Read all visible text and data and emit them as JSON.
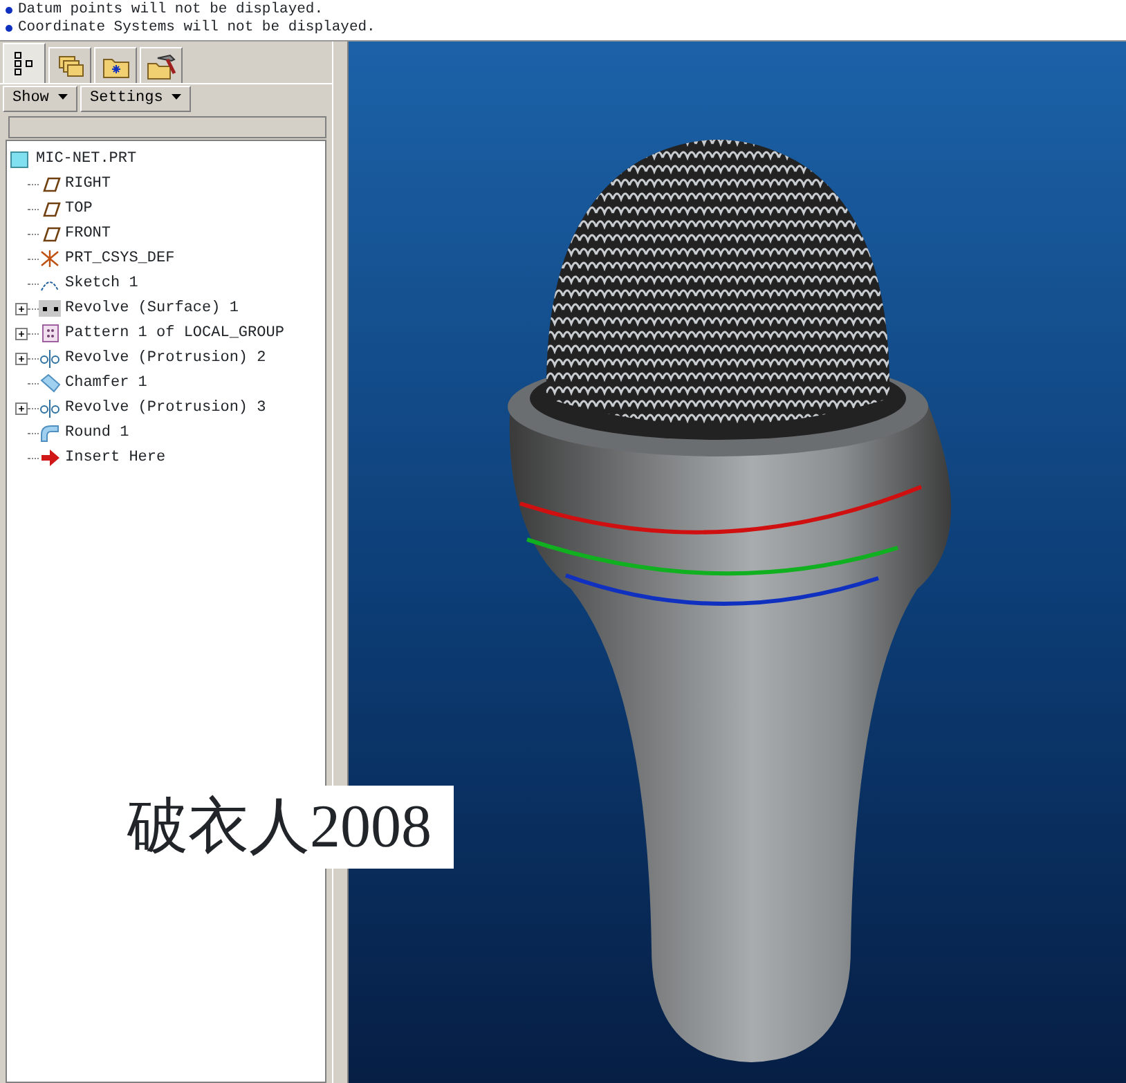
{
  "messages": [
    "Datum points will not be displayed.",
    "Coordinate Systems will not be displayed."
  ],
  "navigator_tabs": [
    {
      "kind": "tree",
      "selected": true
    },
    {
      "kind": "layers",
      "selected": false
    },
    {
      "kind": "folder",
      "selected": false
    },
    {
      "kind": "tools",
      "selected": false
    }
  ],
  "menu_buttons": [
    {
      "label": "Show"
    },
    {
      "label": "Settings"
    }
  ],
  "model_tree": {
    "root": "MIC-NET.PRT",
    "items": [
      {
        "kind": "plane",
        "label": "RIGHT"
      },
      {
        "kind": "plane",
        "label": "TOP"
      },
      {
        "kind": "plane",
        "label": "FRONT"
      },
      {
        "kind": "csys",
        "label": "PRT_CSYS_DEF"
      },
      {
        "kind": "sketch",
        "label": "Sketch 1"
      },
      {
        "kind": "surface",
        "label": "Revolve (Surface) 1",
        "expanded": false
      },
      {
        "kind": "pattern",
        "label": "Pattern 1 of LOCAL_GROUP",
        "expanded": false
      },
      {
        "kind": "revolve",
        "label": "Revolve (Protrusion) 2",
        "expanded": false
      },
      {
        "kind": "chamfer",
        "label": "Chamfer 1"
      },
      {
        "kind": "revolve",
        "label": "Revolve (Protrusion) 3",
        "expanded": false
      },
      {
        "kind": "round",
        "label": "Round 1"
      },
      {
        "kind": "insert",
        "label": "Insert Here"
      }
    ]
  },
  "overlay_caption": "破衣人2008"
}
